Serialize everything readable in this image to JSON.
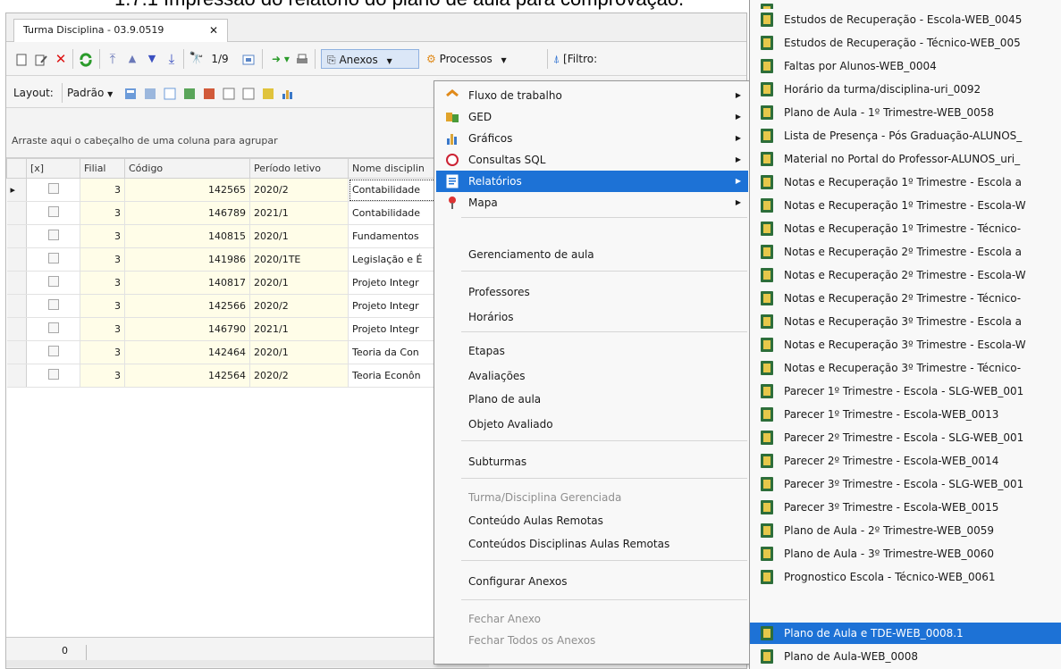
{
  "document_heading": "1.7.1 Impressão do relatório do plano de aula para comprovação.",
  "colors": {
    "highlight": "#1d72d6",
    "menu_bg": "#f8f8f8",
    "grid_yellow": "#fffde8"
  },
  "tab": {
    "title": "Turma Disciplina - 03.9.0519",
    "close_label": "✕"
  },
  "toolbar": {
    "nav_counter": "1/9",
    "anexos_label": "Anexos",
    "processos_label": "Processos",
    "filtro_label": "[Filtro:"
  },
  "toolbar2": {
    "layout_label": "Layout:",
    "padrao_label": "Padrão"
  },
  "group_panel_text": "Arraste aqui o cabeçalho de uma coluna para agrupar",
  "grid": {
    "columns": [
      "[x]",
      "Filial",
      "Código",
      "Período letivo",
      "Nome disciplin"
    ],
    "rows": [
      {
        "filial": "3",
        "codigo": "142565",
        "periodo": "2020/2",
        "nome": "Contabilidade"
      },
      {
        "filial": "3",
        "codigo": "146789",
        "periodo": "2021/1",
        "nome": "Contabilidade"
      },
      {
        "filial": "3",
        "codigo": "140815",
        "periodo": "2020/1",
        "nome": "Fundamentos"
      },
      {
        "filial": "3",
        "codigo": "141986",
        "periodo": "2020/1TE",
        "nome": "Legislação e É"
      },
      {
        "filial": "3",
        "codigo": "140817",
        "periodo": "2020/1",
        "nome": "Projeto Integr"
      },
      {
        "filial": "3",
        "codigo": "142566",
        "periodo": "2020/2",
        "nome": "Projeto Integr"
      },
      {
        "filial": "3",
        "codigo": "146790",
        "periodo": "2021/1",
        "nome": "Projeto Integr"
      },
      {
        "filial": "3",
        "codigo": "142464",
        "periodo": "2020/1",
        "nome": "Teoria da Con"
      },
      {
        "filial": "3",
        "codigo": "142564",
        "periodo": "2020/2",
        "nome": "Teoria Econôn"
      }
    ],
    "footer_count": "0"
  },
  "menu": {
    "items": [
      {
        "label": "Fluxo de trabalho",
        "icon": "workflow-icon"
      },
      {
        "label": "GED",
        "icon": "ged-icon"
      },
      {
        "label": "Gráficos",
        "icon": "chart-icon"
      },
      {
        "label": "Consultas SQL",
        "icon": "sql-icon"
      },
      {
        "label": "Relatórios",
        "icon": "report-icon"
      },
      {
        "label": "Mapa",
        "icon": "map-pin-icon"
      },
      {
        "label": "Gerenciamento de aula"
      },
      {
        "label": "Professores"
      },
      {
        "label": "Horários"
      },
      {
        "label": "Etapas"
      },
      {
        "label": "Avaliações"
      },
      {
        "label": "Plano de aula"
      },
      {
        "label": "Objeto Avaliado"
      },
      {
        "label": "Subturmas"
      },
      {
        "label": "Turma/Disciplina Gerenciada"
      },
      {
        "label": "Conteúdo Aulas Remotas"
      },
      {
        "label": "Conteúdos Disciplinas Aulas Remotas"
      },
      {
        "label": "Configurar Anexos"
      },
      {
        "label": "Fechar Anexo"
      },
      {
        "label": "Fechar Todos os Anexos"
      }
    ]
  },
  "submenu": {
    "items": [
      "Estudos de Recuperação - Escola-WEB_0045",
      "Estudos de Recuperação - Técnico-WEB_005",
      "Faltas por Alunos-WEB_0004",
      "Horário da turma/disciplina-uri_0092",
      "Plano de Aula - 1º Trimestre-WEB_0058",
      "Lista de Presença - Pós Graduação-ALUNOS_",
      "Material no Portal do Professor-ALUNOS_uri_",
      "Notas e Recuperação 1º Trimestre - Escola a",
      "Notas e Recuperação 1º Trimestre - Escola-W",
      "Notas e Recuperação 1º Trimestre - Técnico-",
      "Notas e Recuperação 2º Trimestre - Escola a",
      "Notas e Recuperação 2º Trimestre - Escola-W",
      "Notas e Recuperação 2º Trimestre - Técnico-",
      "Notas e Recuperação 3º Trimestre - Escola a",
      "Notas e Recuperação 3º Trimestre - Escola-W",
      "Notas e Recuperação 3º Trimestre - Técnico-",
      "Parecer 1º Trimestre - Escola - SLG-WEB_001",
      "Parecer 1º Trimestre - Escola-WEB_0013",
      "Parecer 2º Trimestre - Escola - SLG-WEB_001",
      "Parecer 2º Trimestre - Escola-WEB_0014",
      "Parecer 3º Trimestre - Escola - SLG-WEB_001",
      "Parecer 3º Trimestre - Escola-WEB_0015",
      "Plano de Aula - 2º Trimestre-WEB_0059",
      "Plano de Aula - 3º Trimestre-WEB_0060",
      "Prognostico Escola - Técnico-WEB_0061",
      "Plano de Aula e TDE-WEB_0008.1",
      "Plano de Aula-WEB_0008"
    ]
  }
}
